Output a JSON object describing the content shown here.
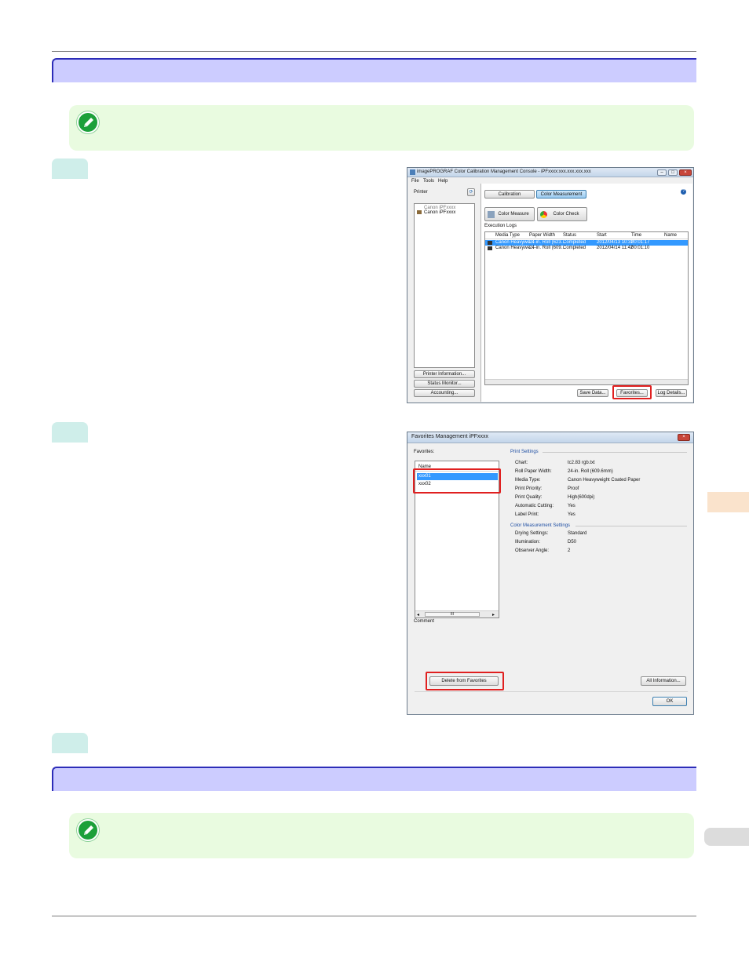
{
  "calibration_window": {
    "title": "imagePROGRAF Color Calibration Management Console - iPFxxxx:xxx.xxx.xxx.xxx",
    "menu": [
      "File",
      "Tools",
      "Help"
    ],
    "printer_label": "Printer",
    "printer_tree": [
      "Canon iPFxxxx",
      "Canon iPFxxxx"
    ],
    "left_buttons": [
      "Printer Information...",
      "Status Monitor...",
      "Accounting..."
    ],
    "tabs": [
      "Calibration",
      "Color Measurement"
    ],
    "active_tab": "Color Measurement",
    "tools": [
      "Color Measure",
      "Color Check"
    ],
    "logs_label": "Execution Logs",
    "columns": [
      "Media Type",
      "Paper Width",
      "Status",
      "Start",
      "Time",
      "Name"
    ],
    "rows": [
      [
        "Canon Heavywe...",
        "24-in. Roll (623...",
        "Completed",
        "2012/04/13 10:32",
        "00:01:17",
        ""
      ],
      [
        "Canon Heavywe...",
        "24-in. Roll (609...",
        "Completed",
        "2012/04/14 11:42",
        "00:01:10",
        ""
      ]
    ],
    "bottom_buttons": [
      "Save Data...",
      "Favorites...",
      "Log Details..."
    ],
    "help_glyph": "?"
  },
  "favorites_window": {
    "title": "Favorites Management iPFxxxx",
    "favorites_label": "Favorites:",
    "list_header": "Name",
    "items": [
      "xxx01",
      "xxx02"
    ],
    "scroll_thumb": "III",
    "comment_label": "Comment",
    "print_settings_title": "Print Settings",
    "print_settings": [
      {
        "k": "Chart:",
        "v": "tc2.83 rgb.txt"
      },
      {
        "k": "Roll Paper Width:",
        "v": "24-in. Roll (609.6mm)"
      },
      {
        "k": "Media Type:",
        "v": "Canon Heavyweight Coated Paper"
      },
      {
        "k": "Print Priority:",
        "v": "Proof"
      },
      {
        "k": "Print Quality:",
        "v": "High(600dpi)"
      },
      {
        "k": "Automatic Cutting:",
        "v": "Yes"
      },
      {
        "k": "Label Print:",
        "v": "Yes"
      }
    ],
    "measure_settings_title": "Color Measurement Settings",
    "measure_settings": [
      {
        "k": "Drying Settings:",
        "v": "Standard"
      },
      {
        "k": "Illumination:",
        "v": "D50"
      },
      {
        "k": "Observer Angle:",
        "v": "2"
      }
    ],
    "delete_button": "Delete from Favorites",
    "all_info_button": "All Information...",
    "ok_button": "OK"
  },
  "colors": {
    "section_bar": "#ccccff",
    "section_border": "#2d2db8",
    "note_bg": "#e9fbe0",
    "note_icon": "#1ca03a",
    "step_tab": "#cfeeea",
    "side_tab_orange": "#fae3cc",
    "side_tab_gray": "#dcdcdc",
    "highlight": "#e02020",
    "selection": "#3399ff"
  },
  "icons": [
    "note-pencil-icon",
    "refresh-icon",
    "help-icon",
    "printer-icon",
    "close-icon"
  ]
}
